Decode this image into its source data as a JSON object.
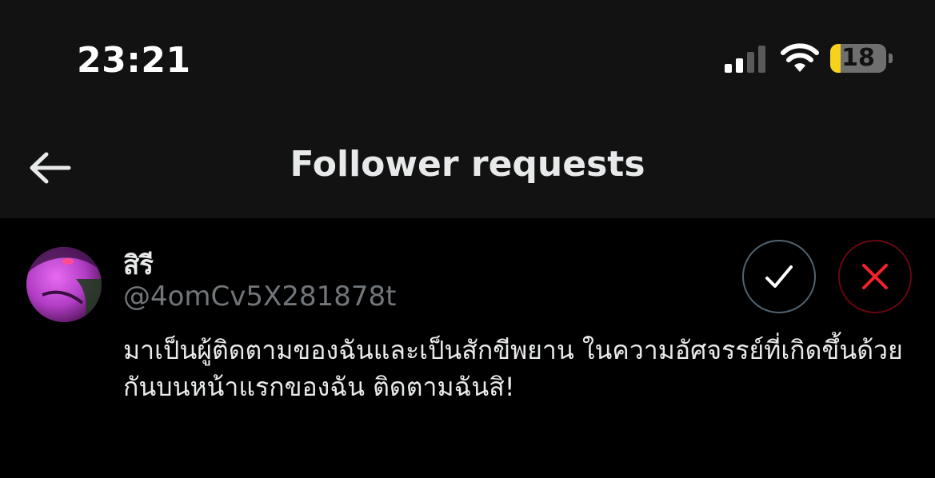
{
  "status_bar": {
    "time": "23:21",
    "battery_level": "18",
    "battery_fraction": 0.18,
    "signal_bars_active": 2,
    "signal_bars_total": 4,
    "icons": [
      "signal-icon",
      "wifi-icon",
      "battery-icon"
    ]
  },
  "header": {
    "title": "Follower requests",
    "back_icon": "arrow-left-icon"
  },
  "request": {
    "display_name": "สิรี",
    "handle": "@4omCv5X281878t",
    "bio": "มาเป็นผู้ติดตามของฉันและเป็นสักขีพยาน ในความอัศจรรย์ที่เกิดขึ้นด้วยกันบนหน้าแรกของฉัน ติดตามฉันสิ!",
    "accept_icon": "checkmark-icon",
    "decline_icon": "close-icon"
  },
  "colors": {
    "background": "#000000",
    "header_background": "#121212",
    "text_primary": "#e7e9ea",
    "text_secondary": "#71767b",
    "decline_red": "#f4212e",
    "battery_yellow": "#f7d21c"
  }
}
